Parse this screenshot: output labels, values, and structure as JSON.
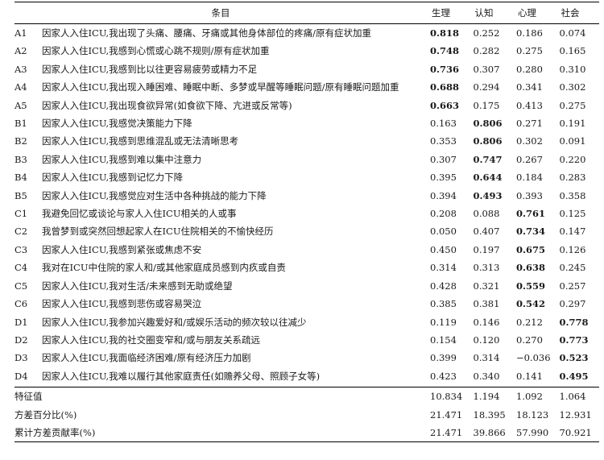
{
  "header": {
    "item": "条目",
    "cols": [
      "生理",
      "认知",
      "心理",
      "社会"
    ]
  },
  "rows": [
    {
      "id": "A1",
      "text": "因家人入住ICU,我出现了头痛、腰痛、牙痛或其他身体部位的疼痛/原有症状加重",
      "values": [
        "0.818",
        "0.252",
        "0.186",
        "0.074"
      ],
      "bold": 0
    },
    {
      "id": "A2",
      "text": "因家人入住ICU,我感到心慌或心跳不规则/原有症状加重",
      "values": [
        "0.748",
        "0.282",
        "0.275",
        "0.165"
      ],
      "bold": 0
    },
    {
      "id": "A3",
      "text": "因家人入住ICU,我感到比以往更容易疲劳或精力不足",
      "values": [
        "0.736",
        "0.307",
        "0.280",
        "0.310"
      ],
      "bold": 0
    },
    {
      "id": "A4",
      "text": "因家人入住ICU,我出现入睡困难、睡眠中断、多梦或早醒等睡眠问题/原有睡眠问题加重",
      "values": [
        "0.688",
        "0.294",
        "0.341",
        "0.302"
      ],
      "bold": 0
    },
    {
      "id": "A5",
      "text": "因家人入住ICU,我出现食欲异常(如食欲下降、亢进或反常等)",
      "values": [
        "0.663",
        "0.175",
        "0.413",
        "0.275"
      ],
      "bold": 0
    },
    {
      "id": "B1",
      "text": "因家人入住ICU,我感觉决策能力下降",
      "values": [
        "0.163",
        "0.806",
        "0.271",
        "0.191"
      ],
      "bold": 1
    },
    {
      "id": "B2",
      "text": "因家人入住ICU,我感到思维混乱或无法清晰思考",
      "values": [
        "0.353",
        "0.806",
        "0.302",
        "0.091"
      ],
      "bold": 1
    },
    {
      "id": "B3",
      "text": "因家人入住ICU,我感到难以集中注意力",
      "values": [
        "0.307",
        "0.747",
        "0.267",
        "0.220"
      ],
      "bold": 1
    },
    {
      "id": "B4",
      "text": "因家人入住ICU,我感到记忆力下降",
      "values": [
        "0.395",
        "0.644",
        "0.184",
        "0.283"
      ],
      "bold": 1
    },
    {
      "id": "B5",
      "text": "因家人入住ICU,我感觉应对生活中各种挑战的能力下降",
      "values": [
        "0.394",
        "0.493",
        "0.393",
        "0.358"
      ],
      "bold": 1
    },
    {
      "id": "C1",
      "text": "我避免回忆或谈论与家人入住ICU相关的人或事",
      "values": [
        "0.208",
        "0.088",
        "0.761",
        "0.125"
      ],
      "bold": 2
    },
    {
      "id": "C2",
      "text": "我曾梦到或突然回想起家人在ICU住院相关的不愉快经历",
      "values": [
        "0.050",
        "0.407",
        "0.734",
        "0.147"
      ],
      "bold": 2
    },
    {
      "id": "C3",
      "text": "因家人入住ICU,我感到紧张或焦虑不安",
      "values": [
        "0.450",
        "0.197",
        "0.675",
        "0.126"
      ],
      "bold": 2
    },
    {
      "id": "C4",
      "text": "我对在ICU中住院的家人和/或其他家庭成员感到内疚或自责",
      "values": [
        "0.314",
        "0.313",
        "0.638",
        "0.245"
      ],
      "bold": 2
    },
    {
      "id": "C5",
      "text": "因家人入住ICU,我对生活/未来感到无助或绝望",
      "values": [
        "0.428",
        "0.321",
        "0.559",
        "0.257"
      ],
      "bold": 2
    },
    {
      "id": "C6",
      "text": "因家人入住ICU,我感到悲伤或容易哭泣",
      "values": [
        "0.385",
        "0.381",
        "0.542",
        "0.297"
      ],
      "bold": 2
    },
    {
      "id": "D1",
      "text": "因家人入住ICU,我参加兴趣爱好和/或娱乐活动的频次较以往减少",
      "values": [
        "0.119",
        "0.146",
        "0.212",
        "0.778"
      ],
      "bold": 3
    },
    {
      "id": "D2",
      "text": "因家人入住ICU,我的社交圈变窄和/或与朋友关系疏远",
      "values": [
        "0.154",
        "0.120",
        "0.270",
        "0.773"
      ],
      "bold": 3
    },
    {
      "id": "D3",
      "text": "因家人入住ICU,我面临经济困难/原有经济压力加剧",
      "values": [
        "0.399",
        "0.314",
        "−0.036",
        "0.523"
      ],
      "bold": 3
    },
    {
      "id": "D4",
      "text": "因家人入住ICU,我难以履行其他家庭责任(如赡养父母、照顾子女等)",
      "values": [
        "0.423",
        "0.340",
        "0.141",
        "0.495"
      ],
      "bold": 3
    }
  ],
  "summary": [
    {
      "label": "特征值",
      "values": [
        "10.834",
        "1.194",
        "1.092",
        "1.064"
      ]
    },
    {
      "label": "方差百分比(%)",
      "values": [
        "21.471",
        "18.395",
        "18.123",
        "12.931"
      ]
    },
    {
      "label": "累计方差贡献率(%)",
      "values": [
        "21.471",
        "39.866",
        "57.990",
        "70.921"
      ]
    }
  ]
}
